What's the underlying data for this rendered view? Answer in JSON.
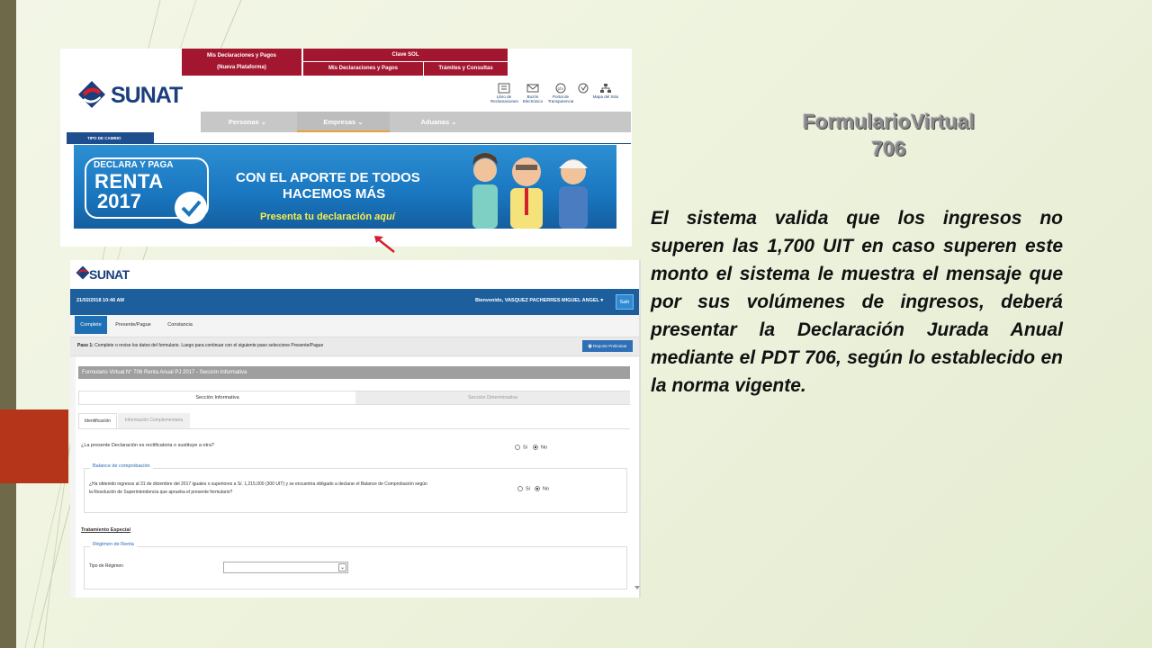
{
  "slide": {
    "title_line1": "FormularioVirtual",
    "title_line2": "706",
    "body": "El sistema valida que los ingresos no superen las 1,700 UIT en caso superen este monto el sistema le muestra el mensaje que por sus volúmenes de ingresos, deberá presentar la Declaración Jurada Anual mediante el PDT 706, según lo establecido en la norma vigente."
  },
  "portal": {
    "tab_mis_decl": "Mis Declaraciones y Pagos",
    "tab_nueva": "(Nueva Plataforma)",
    "tab_clave": "Clave SOL",
    "sub_mis_decl": "Mis Declaraciones y Pagos",
    "sub_tramites": "Trámites y Consultas",
    "logo": "SUNAT",
    "icons": [
      {
        "icon": "book-icon",
        "label": "Libro de Reclamaciones"
      },
      {
        "icon": "mail-icon",
        "label": "Buzón Electrónico"
      },
      {
        "icon": "transparency-icon",
        "label": "Portal de Transparencia"
      },
      {
        "icon": "help-icon",
        "label": ""
      },
      {
        "icon": "sitemap-icon",
        "label": "Mapa del Sitio"
      }
    ],
    "nav": [
      "Personas",
      "Empresas",
      "Aduanas"
    ],
    "tipo_cambio": "TIPO DE CAMBIO",
    "banner": {
      "declara": "DECLARA Y PAGA",
      "renta": "RENTA",
      "year": "2017",
      "line1": "CON EL APORTE DE TODOS",
      "line2": "HACEMOS MÁS",
      "presenta": "Presenta tu declaración",
      "aqui": "aquí"
    }
  },
  "form": {
    "logo": "SUNAT",
    "date": "21/02/2018 10:46 AM",
    "welcome": "Bienvenido, VASQUEZ PACHERRES MIGUEL ANGEL",
    "salir": "Salir",
    "steps": [
      "Complete",
      "Presente/Pague",
      "Constancia"
    ],
    "paso_bold": "Paso 1:",
    "paso_text": " Complete o revise los datos del formulario. Luego para continuar con el siguiente paso seleccione Presente/Pague",
    "reporte": "Reporte Preliminar",
    "title": "Formulario Virtual N° 706 Renta Anual PJ 2017 - Sección Informativa",
    "section_tabs": [
      "Sección Informativa",
      "Sección Determinativa"
    ],
    "sub_tabs": [
      "Identificación",
      "Información Complementaria"
    ],
    "q1": "¿La presente Declaración es rectificatoria o sustituye a otra?",
    "si": "Si",
    "no": "No",
    "balance_legend": "Balance de comprobación",
    "q2": "¿Ha obtenido ingresos al 31 de diciembre del 2017 iguales o superiores a S/. 1,215,000 (300 UIT) y se encuentra obligado a declarar el Balance de Comprobación según la Resolución de Superintendencia que aprueba el presente formulario?",
    "tratamiento": "Tratamiento Especial",
    "regimen_legend": "Régimen de Renta",
    "tipo_regimen": "Tipo de Régimen"
  },
  "colors": {
    "sunat_red": "#a3162f",
    "sunat_blue": "#1b3e7c",
    "header_blue": "#1c5f9c",
    "accent_orange": "#b5351b"
  }
}
